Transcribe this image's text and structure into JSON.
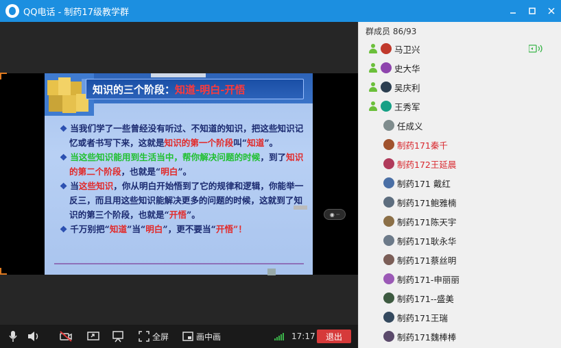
{
  "window": {
    "title": "QQ电话 - 制药17级教学群"
  },
  "slide": {
    "title_prefix": "知识的三个阶段：",
    "title_highlight": "知道-明白-开悟",
    "paras": [
      {
        "bullet": "❖",
        "parts": [
          {
            "t": "当我们学了一些曾经没有听过、不知道的知识，把这些知识记忆或者书写下来，这就是",
            "c": "b"
          },
          {
            "t": "知识的第一个阶段",
            "c": "r"
          },
          {
            "t": "叫“",
            "c": "b"
          },
          {
            "t": "知道",
            "c": "r"
          },
          {
            "t": "”。",
            "c": "b"
          }
        ]
      },
      {
        "bullet": "❖",
        "parts": [
          {
            "t": "当这些知识能用到生活当中，帮你解决问题的时候",
            "c": "g"
          },
          {
            "t": "，到了",
            "c": "b"
          },
          {
            "t": "知识的第二个阶段",
            "c": "r"
          },
          {
            "t": "，也就是“",
            "c": "b"
          },
          {
            "t": "明白",
            "c": "r"
          },
          {
            "t": "”。",
            "c": "b"
          }
        ]
      },
      {
        "bullet": "❖",
        "parts": [
          {
            "t": "当",
            "c": "b"
          },
          {
            "t": "这些知识",
            "c": "r"
          },
          {
            "t": "，",
            "c": "b"
          },
          {
            "t": "你从明白开始悟到了它的规律和逻辑，你能举一反三，而且用这些知识能解决更多的问题的时候",
            "c": "b"
          },
          {
            "t": "，这就到了知识的第三个阶段，也就是“",
            "c": "b"
          },
          {
            "t": "开悟",
            "c": "r"
          },
          {
            "t": "”。",
            "c": "b"
          }
        ]
      },
      {
        "bullet": "❖",
        "parts": [
          {
            "t": "千万别把“",
            "c": "b"
          },
          {
            "t": "知道",
            "c": "r"
          },
          {
            "t": "”当“",
            "c": "b"
          },
          {
            "t": "明白",
            "c": "r"
          },
          {
            "t": "”，更不要当“",
            "c": "b"
          },
          {
            "t": "开悟",
            "c": "r"
          },
          {
            "t": "”！",
            "c": "r"
          }
        ]
      }
    ]
  },
  "toolbar": {
    "fullscreen_label": "全屏",
    "pip_label": "画中画",
    "time": "17:17",
    "hangup_label": "退出"
  },
  "members": {
    "count_label": "群成员 86/93",
    "list": [
      {
        "name": "马卫兴",
        "red": false,
        "presence": true,
        "speaking": true
      },
      {
        "name": "史大华",
        "red": false,
        "presence": true
      },
      {
        "name": "吴庆利",
        "red": false,
        "presence": true
      },
      {
        "name": "王秀军",
        "red": false,
        "presence": true
      },
      {
        "name": "任成义",
        "red": false,
        "presence": false
      },
      {
        "name": "制药171秦千",
        "red": true,
        "presence": false
      },
      {
        "name": "制药172王延晨",
        "red": true,
        "presence": false
      },
      {
        "name": "制药171 戴红",
        "red": false,
        "presence": false
      },
      {
        "name": "制药171鲍雅楠",
        "red": false,
        "presence": false
      },
      {
        "name": "制药171陈天宇",
        "red": false,
        "presence": false
      },
      {
        "name": "制药171耿永华",
        "red": false,
        "presence": false
      },
      {
        "name": "制药171蔡丝明",
        "red": false,
        "presence": false
      },
      {
        "name": "制药171-申丽丽",
        "red": false,
        "presence": false
      },
      {
        "name": "制药171--盛美",
        "red": false,
        "presence": false
      },
      {
        "name": "制药171王瑞",
        "red": false,
        "presence": false
      },
      {
        "name": "制药171魏棒棒",
        "red": false,
        "presence": false
      }
    ]
  },
  "colors": {
    "titlebar": "#1c8fe0",
    "hangup": "#d63a3a",
    "name_highlight": "#d8262c"
  }
}
